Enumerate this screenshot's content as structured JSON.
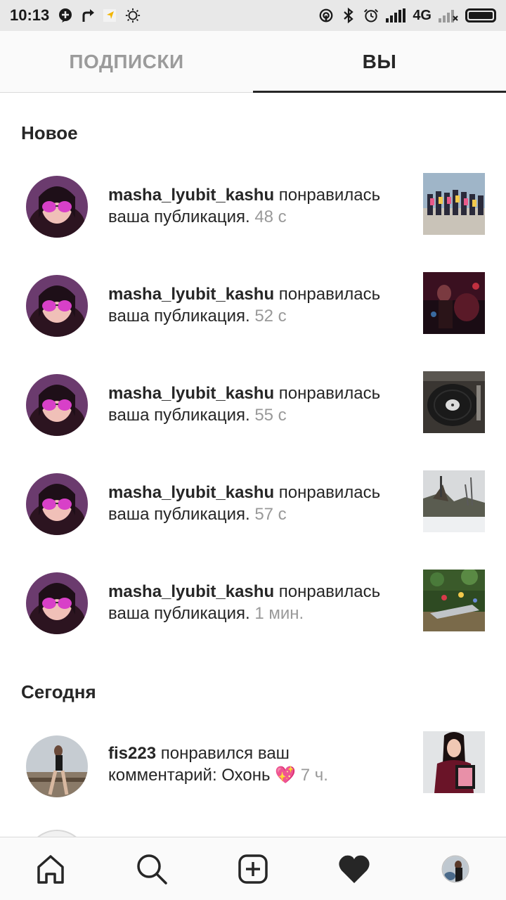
{
  "status_bar": {
    "time": "10:13",
    "network": "4G",
    "icons_left": [
      "chat-bubble-icon",
      "route-arrow-icon",
      "location-icon",
      "brightness-icon"
    ],
    "icons_right": [
      "hotspot-icon",
      "bluetooth-icon",
      "alarm-icon",
      "signal-icon",
      "signal-icon-2",
      "battery-icon"
    ]
  },
  "tabs": [
    {
      "label": "ПОДПИСКИ",
      "active": false
    },
    {
      "label": "ВЫ",
      "active": true
    }
  ],
  "sections": {
    "new": "Новое",
    "today": "Сегодня"
  },
  "notifications_new": [
    {
      "user": "masha_lyubit_kashu",
      "line1": " понравилась",
      "line2": "ваша публикация.",
      "time": "48 с"
    },
    {
      "user": "masha_lyubit_kashu",
      "line1": " понравилась",
      "line2": "ваша публикация.",
      "time": "52 с"
    },
    {
      "user": "masha_lyubit_kashu",
      "line1": " понравилась",
      "line2": "ваша публикация.",
      "time": "55 с"
    },
    {
      "user": "masha_lyubit_kashu",
      "line1": " понравилась",
      "line2": "ваша публикация.",
      "time": "57 с"
    },
    {
      "user": "masha_lyubit_kashu",
      "line1": " понравилась",
      "line2": "ваша публикация.",
      "time": "1 мин."
    }
  ],
  "notifications_today": [
    {
      "user": "fis223",
      "line1": " понравился ваш",
      "line2": "комментарий: Охонь",
      "emoji": "💖",
      "time": "7 ч."
    }
  ],
  "bottom_nav": [
    "home-icon",
    "search-icon",
    "add-post-icon",
    "activity-heart-icon",
    "profile-avatar-icon"
  ],
  "colors": {
    "text": "#262626",
    "muted": "#999999",
    "tab_inactive": "#9b9b9b",
    "heart": "#d93a5a"
  }
}
